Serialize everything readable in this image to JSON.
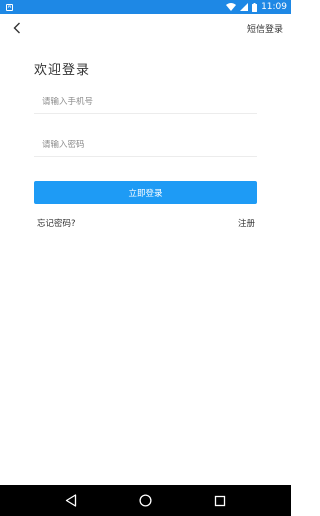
{
  "status_bar": {
    "app_icon_glyph": "A",
    "time": "11:09",
    "icons": [
      "wifi-icon",
      "signal-icon",
      "battery-icon"
    ]
  },
  "top_bar": {
    "back_icon": "chevron-left-icon",
    "sms_login_label": "短信登录"
  },
  "form": {
    "title": "欢迎登录",
    "phone_placeholder": "请输入手机号",
    "phone_value": "",
    "password_placeholder": "请输入密码",
    "password_value": "",
    "submit_label": "立即登录",
    "forgot_label": "忘记密码?",
    "register_label": "注册"
  },
  "nav_bar": {
    "icons": [
      "back-triangle-icon",
      "home-circle-icon",
      "recents-square-icon"
    ]
  },
  "colors": {
    "status_bar": "#1e88e5",
    "primary_button": "#1e9bf5",
    "nav_bar": "#000000"
  }
}
